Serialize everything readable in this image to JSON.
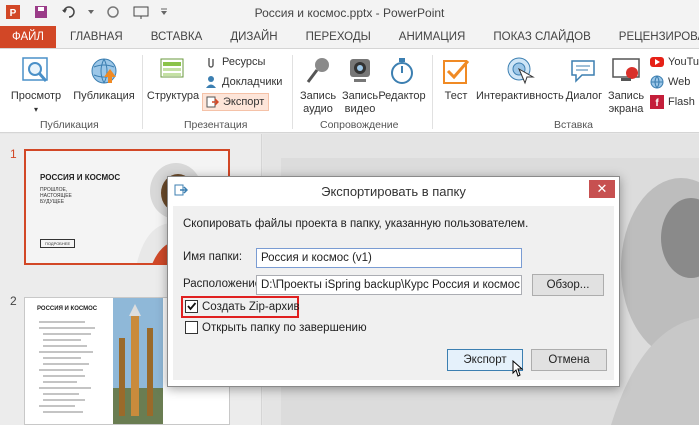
{
  "window": {
    "title": "Россия и космос.pptx - PowerPoint"
  },
  "tabs": [
    {
      "label": "ФАЙЛ"
    },
    {
      "label": "ГЛАВНАЯ"
    },
    {
      "label": "ВСТАВКА"
    },
    {
      "label": "ДИЗАЙН"
    },
    {
      "label": "ПЕРЕХОДЫ"
    },
    {
      "label": "АНИМАЦИЯ"
    },
    {
      "label": "ПОКАЗ СЛАЙДОВ"
    },
    {
      "label": "РЕЦЕНЗИРОВАНИЕ"
    }
  ],
  "ribbon": {
    "preview": "Просмотр",
    "publish": "Публикация",
    "structure": "Структура",
    "resources": "Ресурсы",
    "speakers": "Докладчики",
    "export": "Экспорт",
    "record_audio_1": "Запись",
    "record_audio_2": "аудио",
    "record_video_1": "Запись",
    "record_video_2": "видео",
    "editor": "Редактор",
    "test": "Тест",
    "interactivity": "Интерактивность",
    "dialog": "Диалог",
    "record_screen_1": "Запись",
    "record_screen_2": "экрана",
    "youtube": "YouTu",
    "web": "Web",
    "flash": "Flash",
    "groups": {
      "publication": "Публикация",
      "presentation": "Презентация",
      "accompaniment": "Сопровождение",
      "insert": "Вставка"
    }
  },
  "slides": {
    "num1": "1",
    "num2": "2",
    "thumb1_title": "РОССИЯ И КОСМОС",
    "thumb1_lines": [
      "ПРОШЛОЕ,",
      "НАСТОЯЩЕЕ",
      "БУДУЩЕЕ"
    ],
    "thumb1_btn": "ПОДРОБНЕЕ",
    "thumb2_title": "РОССИЯ И КОСМОС"
  },
  "dialog": {
    "title": "Экспортировать в папку",
    "close": "✕",
    "description": "Скопировать файлы проекта в папку, указанную пользователем.",
    "folder_label": "Имя папки:",
    "folder_value": "Россия и космос (v1)",
    "location_label": "Расположение:",
    "location_value": "D:\\Проекты iSpring backup\\Курс Россия и космос",
    "browse": "Обзор...",
    "zip_label": "Создать Zip-архив",
    "zip_checked": true,
    "open_label": "Открыть папку по завершению",
    "open_checked": false,
    "export": "Экспорт",
    "cancel": "Отмена"
  },
  "colors": {
    "accent": "#d24726",
    "highlight_frame": "#e02020"
  }
}
